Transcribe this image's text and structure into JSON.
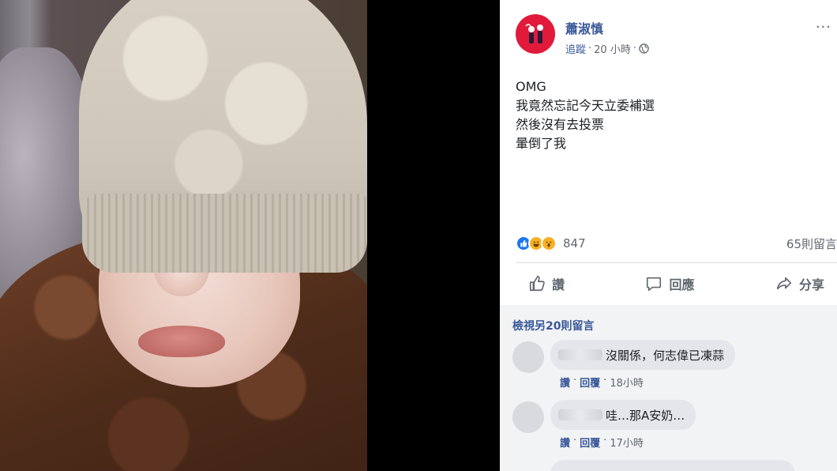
{
  "post": {
    "author": "蕭淑慎",
    "follow_label": "追蹤",
    "separator": "·",
    "time_label": "20 小時",
    "more_label": "···",
    "text_lines": [
      "OMG",
      "我竟然忘記今天立委補選",
      "然後沒有去投票",
      "暈倒了我"
    ]
  },
  "reactions": {
    "count": "847",
    "comments_label": "65則留言",
    "icons": [
      "like-icon",
      "haha-icon",
      "wow-icon"
    ]
  },
  "actions": {
    "like_label": "讚",
    "comment_label": "回應",
    "share_label": "分享"
  },
  "comments": {
    "view_more_label": "檢視另20則留言",
    "items": [
      {
        "text": "沒關係，何志偉已凍蒜",
        "like_label": "讚",
        "reply_label": "回覆",
        "time": "18小時"
      },
      {
        "text": "哇…那A安奶…",
        "like_label": "讚",
        "reply_label": "回覆",
        "time": "17小時"
      }
    ]
  },
  "colors": {
    "link": "#385898",
    "like_blue": "#1877f2",
    "avatar_red": "#e11a3b",
    "comment_bg": "#f2f3f5"
  }
}
